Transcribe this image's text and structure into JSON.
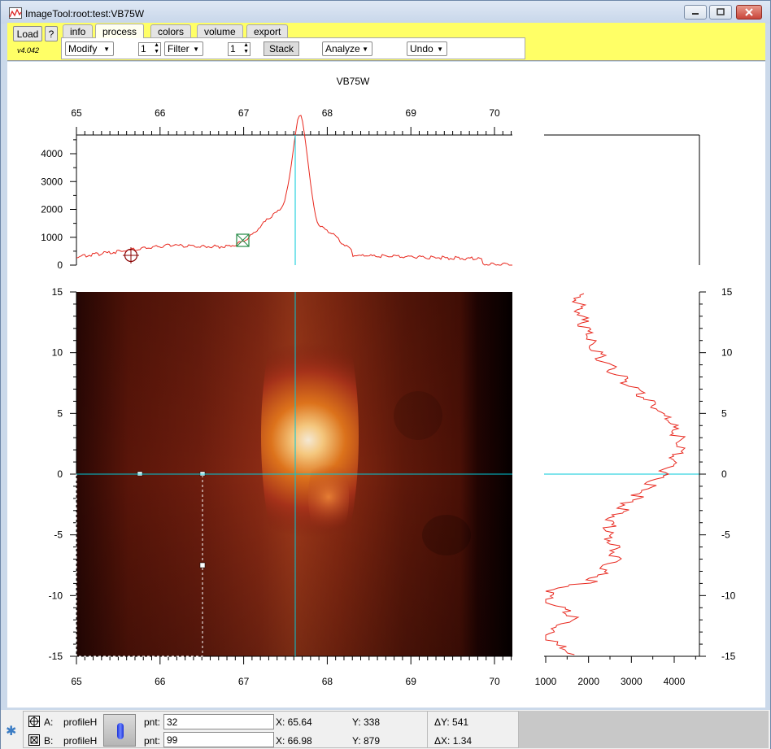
{
  "window": {
    "title": "ImageTool:root:test:VB75W"
  },
  "toolbar": {
    "load_label": "Load",
    "help_label": "?",
    "version": "v4.042",
    "tabs": [
      "info",
      "process",
      "colors",
      "volume",
      "export"
    ],
    "active_tab": "process",
    "modify_label": "Modify",
    "filter_value": "1",
    "filter_label": "Filter",
    "stack_value": "1",
    "stack_label": "Stack",
    "analyze_label": "Analyze",
    "undo_label": "Undo",
    "accent_color": "#ffff66"
  },
  "plot": {
    "title": "VB75W",
    "top_x_ticks": [
      "65",
      "66",
      "67",
      "68",
      "69",
      "70"
    ],
    "bottom_x_ticks": [
      "65",
      "66",
      "67",
      "68",
      "69",
      "70"
    ],
    "profile_y_ticks": [
      "4000",
      "3000",
      "2000",
      "1000",
      "0"
    ],
    "image_y_ticks": [
      "15",
      "10",
      "5",
      "0",
      "-5",
      "-10",
      "-15"
    ],
    "right_y_ticks": [
      "15",
      "10",
      "5",
      "0",
      "-5",
      "-10",
      "-15"
    ],
    "right_x_ticks": [
      "1000",
      "2000",
      "3000",
      "4000"
    ],
    "cursor_color": "#00c8d8",
    "profile_color": "#e8271d",
    "colormap": "hot"
  },
  "status": {
    "cursorA": {
      "label": "A:",
      "wave": "profileH",
      "pnt_label": "pnt:",
      "pnt": "32",
      "x": "X: 65.64",
      "y": "Y: 338",
      "delta": "ΔY: 541"
    },
    "cursorB": {
      "label": "B:",
      "wave": "profileH",
      "pnt_label": "pnt:",
      "pnt": "99",
      "x": "X: 66.98",
      "y": "Y: 879",
      "delta": "ΔX: 1.34"
    }
  }
}
